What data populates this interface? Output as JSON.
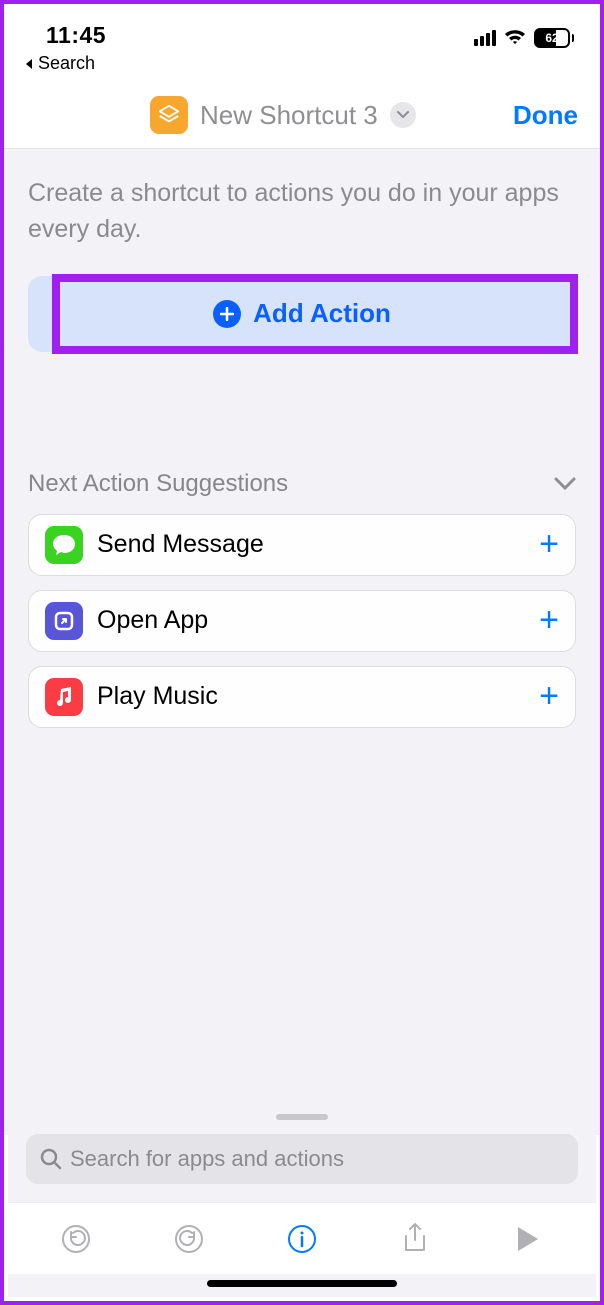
{
  "status": {
    "time": "11:45",
    "back_label": "Search",
    "battery": "62"
  },
  "header": {
    "title": "New Shortcut 3",
    "done": "Done"
  },
  "instruction": "Create a shortcut to actions you do in your apps every day.",
  "add_action": "Add Action",
  "suggestions_title": "Next Action Suggestions",
  "suggestions": [
    {
      "label": "Send Message",
      "icon": "messages"
    },
    {
      "label": "Open App",
      "icon": "shortcuts"
    },
    {
      "label": "Play Music",
      "icon": "music"
    }
  ],
  "search_placeholder": "Search for apps and actions"
}
